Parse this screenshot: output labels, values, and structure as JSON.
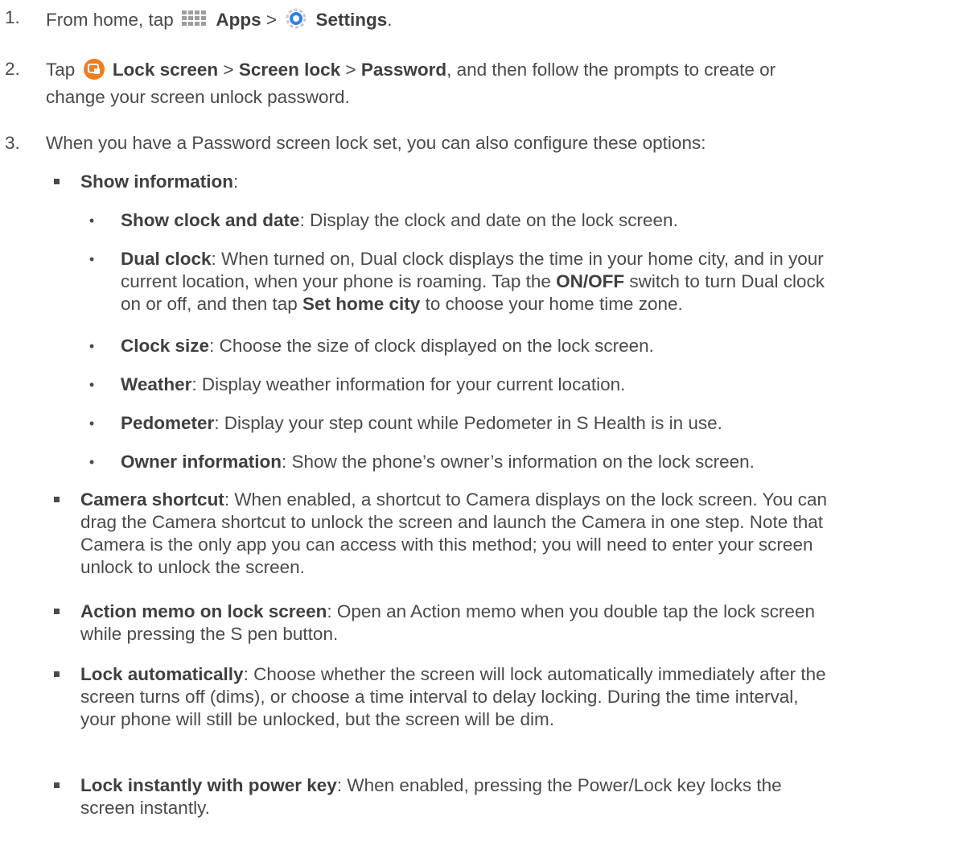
{
  "steps": [
    {
      "number": "1.",
      "t1": "From home, tap",
      "apps_label": "Apps",
      "sep": ">",
      "settings_label": "Settings",
      "end": "."
    },
    {
      "number": "2.",
      "t1": "Tap",
      "lock_screen": "Lock screen",
      "sep1": ">",
      "screen_lock": "Screen lock",
      "sep2": ">",
      "password": "Password",
      "line1_rest": ", and then follow the prompts to create or",
      "line2": "change your screen unlock password."
    },
    {
      "number": "3.",
      "text": "When you have a Password screen lock set, you can also configure these options:"
    }
  ],
  "show_information": {
    "term": "Show information",
    "suffix": ":"
  },
  "sub_options": [
    {
      "term": "Show clock and date",
      "lines": [
        ": Display the clock and date on the lock screen."
      ]
    },
    {
      "term": "Dual clock",
      "line1": ": When turned on, Dual clock displays the time in your home city, and in your",
      "line2": "current location, when your phone is roaming. Tap the ",
      "onoff": "ON/OFF",
      "line2_rest": " switch to turn Dual clock",
      "line3_start": "on or off, and then tap ",
      "set_home_city": "Set home city",
      "line3_rest": " to choose your home time zone."
    },
    {
      "term": "Clock size",
      "lines": [
        ": Choose the size of clock displayed on the lock screen."
      ]
    },
    {
      "term": "Weather",
      "lines": [
        ": Display weather information for your current location."
      ]
    },
    {
      "term": "Pedometer",
      "lines": [
        ": Display your step count while Pedometer in S Health is in use."
      ]
    },
    {
      "term": "Owner information",
      "lines": [
        ": Show the phone’s owner’s information on the lock screen."
      ]
    }
  ],
  "options": [
    {
      "term": "Camera shortcut",
      "first": ": When enabled, a shortcut to Camera displays on the lock screen. You can",
      "lines": [
        "drag the Camera shortcut to unlock the screen and launch the Camera in one step. Note that",
        "Camera is the only app you can access with this method; you will need to enter your screen",
        "unlock to unlock the screen."
      ]
    },
    {
      "term": "Action memo on lock screen",
      "first": ": Open an Action memo when you double tap the lock screen",
      "lines": [
        "while pressing the S pen button."
      ]
    },
    {
      "term": "Lock automatically",
      "first": ": Choose whether the screen will lock automatically immediately after the",
      "lines": [
        "screen turns off (dims), or choose a time interval to delay locking. During the time interval,",
        "your phone will still be unlocked, but the screen will be dim."
      ]
    },
    {
      "term": "Lock instantly with power key",
      "first": ": When enabled, pressing the Power/Lock key locks the",
      "lines": [
        "screen instantly."
      ]
    }
  ],
  "colors": {
    "text": "#4a4a4a",
    "apps_icon": "#9e9e9e",
    "settings_icon": "#2f80ed",
    "lock_icon": "#f27c1e"
  },
  "icons": {
    "apps": "apps-grid-icon",
    "settings": "settings-gear-icon",
    "lock_screen": "lock-screen-icon"
  }
}
